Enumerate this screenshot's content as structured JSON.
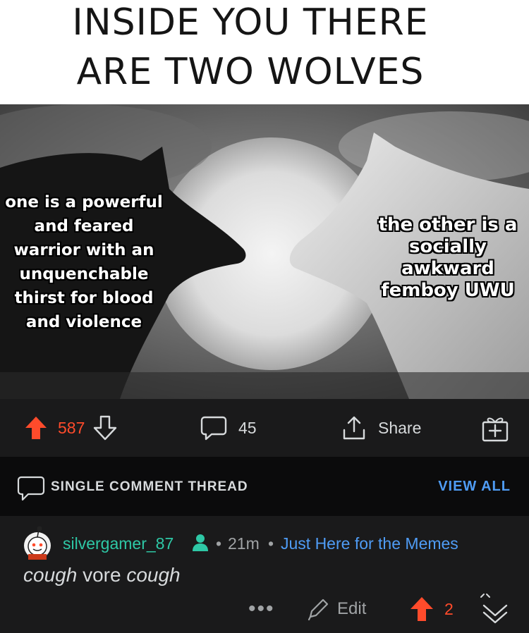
{
  "meme": {
    "caption_line1": "INSIDE YOU THERE",
    "caption_line2": "ARE TWO WOLVES",
    "left_text": "one is a powerful and feared warrior with an unquenchable thirst for blood and violence",
    "right_text": "the other is a socially awkward femboy UWU"
  },
  "post_actions": {
    "upvote_count": "587",
    "comment_count": "45",
    "share_label": "Share"
  },
  "thread": {
    "title": "SINGLE COMMENT THREAD",
    "view_all": "VIEW ALL"
  },
  "comment": {
    "username": "silvergamer_87",
    "separator": "•",
    "time": "21m",
    "flair": "Just Here for the Memes",
    "body_part1": "cough",
    "body_part2": " vore ",
    "body_part3": "cough",
    "more_label": "•••",
    "edit_label": "Edit",
    "vote_count": "2"
  },
  "colors": {
    "upvote": "#ff4b2b",
    "link": "#4f9cf5",
    "username": "#2ec8a6",
    "text": "#d7dadc",
    "background": "#1a1a1b"
  },
  "icons": {
    "upvote": "upvote-arrow-icon",
    "downvote": "downvote-arrow-icon",
    "comment": "comment-bubble-icon",
    "share": "share-icon",
    "award": "gift-award-icon",
    "edit": "pencil-icon",
    "collapse": "collapse-chevron-icon",
    "mod": "person-icon"
  }
}
